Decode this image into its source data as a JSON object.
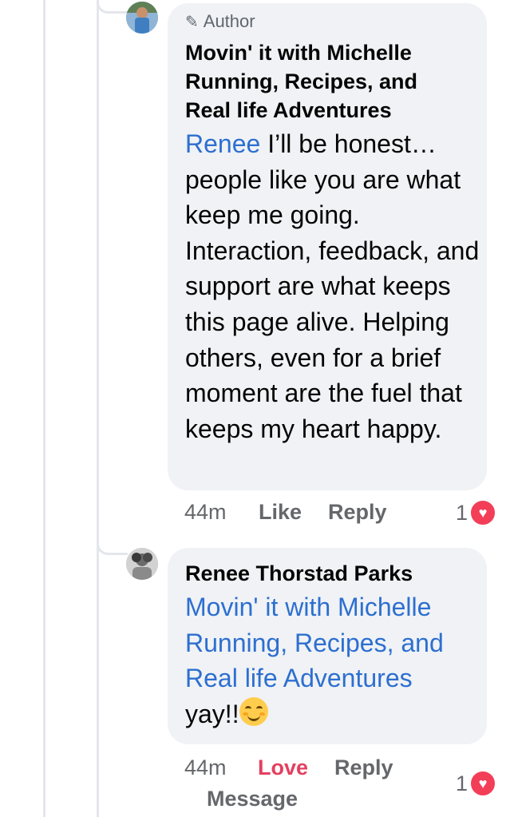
{
  "comments": [
    {
      "author_badge": "Author",
      "name_lines": [
        "Movin' it with Michelle",
        "Running, Recipes, and",
        "Real life Adventures"
      ],
      "mention": "Renee",
      "body": " I’ll be honest… people like you are what keep me going. Interaction, feedback, and support are what keeps this page alive. Helping others, even for a brief moment are the fuel that keeps my heart happy.",
      "actions": {
        "time": "44m",
        "like": "Like",
        "reply": "Reply"
      },
      "reaction_count": "1"
    },
    {
      "name": "Renee Thorstad Parks",
      "mention_lines": [
        "Movin' it with Michelle",
        "Running, Recipes, and",
        "Real life Adventures"
      ],
      "body": "yay!!",
      "actions": {
        "time": "44m",
        "love": "Love",
        "reply": "Reply",
        "message": "Message"
      },
      "reaction_count": "1"
    }
  ],
  "icons": {
    "author": "pencil-icon",
    "reaction": "heart-icon",
    "emoji": "smiling-face-emoji"
  },
  "colors": {
    "mention": "#2d6fd0",
    "love": "#e4405f",
    "heart": "#f33e58",
    "bubble": "#f0f2f5"
  }
}
